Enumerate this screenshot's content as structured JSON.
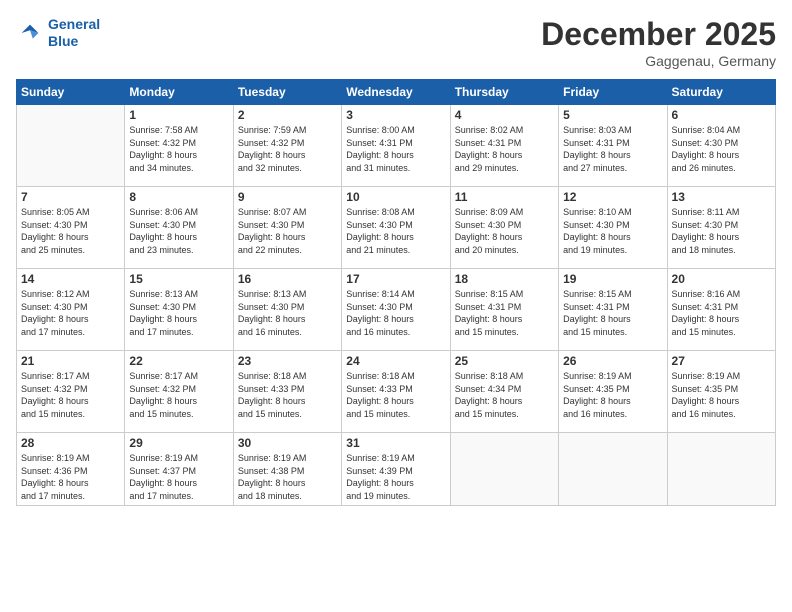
{
  "header": {
    "logo_line1": "General",
    "logo_line2": "Blue",
    "month_title": "December 2025",
    "location": "Gaggenau, Germany"
  },
  "weekdays": [
    "Sunday",
    "Monday",
    "Tuesday",
    "Wednesday",
    "Thursday",
    "Friday",
    "Saturday"
  ],
  "weeks": [
    [
      {
        "day": "",
        "info": ""
      },
      {
        "day": "1",
        "info": "Sunrise: 7:58 AM\nSunset: 4:32 PM\nDaylight: 8 hours\nand 34 minutes."
      },
      {
        "day": "2",
        "info": "Sunrise: 7:59 AM\nSunset: 4:32 PM\nDaylight: 8 hours\nand 32 minutes."
      },
      {
        "day": "3",
        "info": "Sunrise: 8:00 AM\nSunset: 4:31 PM\nDaylight: 8 hours\nand 31 minutes."
      },
      {
        "day": "4",
        "info": "Sunrise: 8:02 AM\nSunset: 4:31 PM\nDaylight: 8 hours\nand 29 minutes."
      },
      {
        "day": "5",
        "info": "Sunrise: 8:03 AM\nSunset: 4:31 PM\nDaylight: 8 hours\nand 27 minutes."
      },
      {
        "day": "6",
        "info": "Sunrise: 8:04 AM\nSunset: 4:30 PM\nDaylight: 8 hours\nand 26 minutes."
      }
    ],
    [
      {
        "day": "7",
        "info": "Sunrise: 8:05 AM\nSunset: 4:30 PM\nDaylight: 8 hours\nand 25 minutes."
      },
      {
        "day": "8",
        "info": "Sunrise: 8:06 AM\nSunset: 4:30 PM\nDaylight: 8 hours\nand 23 minutes."
      },
      {
        "day": "9",
        "info": "Sunrise: 8:07 AM\nSunset: 4:30 PM\nDaylight: 8 hours\nand 22 minutes."
      },
      {
        "day": "10",
        "info": "Sunrise: 8:08 AM\nSunset: 4:30 PM\nDaylight: 8 hours\nand 21 minutes."
      },
      {
        "day": "11",
        "info": "Sunrise: 8:09 AM\nSunset: 4:30 PM\nDaylight: 8 hours\nand 20 minutes."
      },
      {
        "day": "12",
        "info": "Sunrise: 8:10 AM\nSunset: 4:30 PM\nDaylight: 8 hours\nand 19 minutes."
      },
      {
        "day": "13",
        "info": "Sunrise: 8:11 AM\nSunset: 4:30 PM\nDaylight: 8 hours\nand 18 minutes."
      }
    ],
    [
      {
        "day": "14",
        "info": "Sunrise: 8:12 AM\nSunset: 4:30 PM\nDaylight: 8 hours\nand 17 minutes."
      },
      {
        "day": "15",
        "info": "Sunrise: 8:13 AM\nSunset: 4:30 PM\nDaylight: 8 hours\nand 17 minutes."
      },
      {
        "day": "16",
        "info": "Sunrise: 8:13 AM\nSunset: 4:30 PM\nDaylight: 8 hours\nand 16 minutes."
      },
      {
        "day": "17",
        "info": "Sunrise: 8:14 AM\nSunset: 4:30 PM\nDaylight: 8 hours\nand 16 minutes."
      },
      {
        "day": "18",
        "info": "Sunrise: 8:15 AM\nSunset: 4:31 PM\nDaylight: 8 hours\nand 15 minutes."
      },
      {
        "day": "19",
        "info": "Sunrise: 8:15 AM\nSunset: 4:31 PM\nDaylight: 8 hours\nand 15 minutes."
      },
      {
        "day": "20",
        "info": "Sunrise: 8:16 AM\nSunset: 4:31 PM\nDaylight: 8 hours\nand 15 minutes."
      }
    ],
    [
      {
        "day": "21",
        "info": "Sunrise: 8:17 AM\nSunset: 4:32 PM\nDaylight: 8 hours\nand 15 minutes."
      },
      {
        "day": "22",
        "info": "Sunrise: 8:17 AM\nSunset: 4:32 PM\nDaylight: 8 hours\nand 15 minutes."
      },
      {
        "day": "23",
        "info": "Sunrise: 8:18 AM\nSunset: 4:33 PM\nDaylight: 8 hours\nand 15 minutes."
      },
      {
        "day": "24",
        "info": "Sunrise: 8:18 AM\nSunset: 4:33 PM\nDaylight: 8 hours\nand 15 minutes."
      },
      {
        "day": "25",
        "info": "Sunrise: 8:18 AM\nSunset: 4:34 PM\nDaylight: 8 hours\nand 15 minutes."
      },
      {
        "day": "26",
        "info": "Sunrise: 8:19 AM\nSunset: 4:35 PM\nDaylight: 8 hours\nand 16 minutes."
      },
      {
        "day": "27",
        "info": "Sunrise: 8:19 AM\nSunset: 4:35 PM\nDaylight: 8 hours\nand 16 minutes."
      }
    ],
    [
      {
        "day": "28",
        "info": "Sunrise: 8:19 AM\nSunset: 4:36 PM\nDaylight: 8 hours\nand 17 minutes."
      },
      {
        "day": "29",
        "info": "Sunrise: 8:19 AM\nSunset: 4:37 PM\nDaylight: 8 hours\nand 17 minutes."
      },
      {
        "day": "30",
        "info": "Sunrise: 8:19 AM\nSunset: 4:38 PM\nDaylight: 8 hours\nand 18 minutes."
      },
      {
        "day": "31",
        "info": "Sunrise: 8:19 AM\nSunset: 4:39 PM\nDaylight: 8 hours\nand 19 minutes."
      },
      {
        "day": "",
        "info": ""
      },
      {
        "day": "",
        "info": ""
      },
      {
        "day": "",
        "info": ""
      }
    ]
  ]
}
